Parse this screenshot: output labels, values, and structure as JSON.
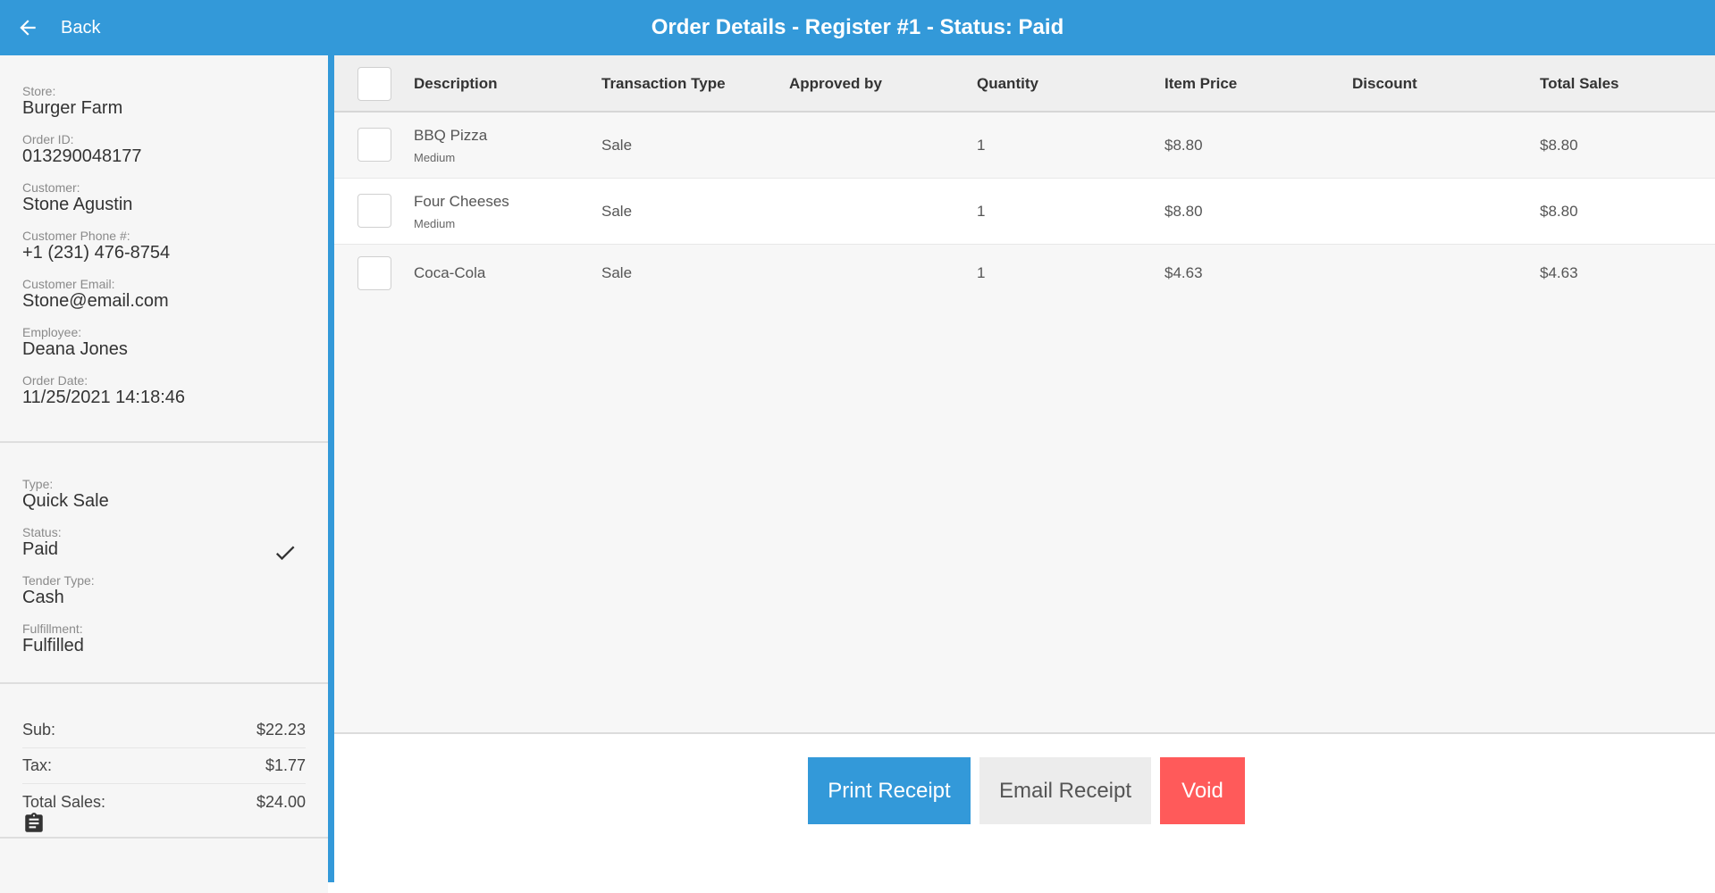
{
  "header": {
    "back_label": "Back",
    "title": "Order Details - Register #1 - Status: Paid"
  },
  "sidebar": {
    "order_info": [
      {
        "label": "Store:",
        "value": "Burger Farm"
      },
      {
        "label": "Order ID:",
        "value": "013290048177"
      },
      {
        "label": "Customer:",
        "value": "Stone Agustin"
      },
      {
        "label": "Customer Phone #:",
        "value": "+1 (231) 476-8754"
      },
      {
        "label": "Customer Email:",
        "value": "Stone@email.com"
      },
      {
        "label": "Employee:",
        "value": "Deana Jones"
      },
      {
        "label": "Order Date:",
        "value": "11/25/2021 14:18:46"
      }
    ],
    "status_info": [
      {
        "label": "Type:",
        "value": "Quick Sale"
      },
      {
        "label": "Status:",
        "value": "Paid"
      },
      {
        "label": "Tender Type:",
        "value": "Cash"
      },
      {
        "label": "Fulfillment:",
        "value": "Fulfilled"
      }
    ],
    "totals": [
      {
        "label": "Sub:",
        "value": "$22.23"
      },
      {
        "label": "Tax:",
        "value": "$1.77"
      },
      {
        "label": "Total Sales:",
        "value": "$24.00"
      }
    ]
  },
  "table": {
    "columns": [
      "Description",
      "Transaction Type",
      "Approved by",
      "Quantity",
      "Item Price",
      "Discount",
      "Total Sales"
    ],
    "rows": [
      {
        "description": "BBQ Pizza",
        "modifier": "Medium",
        "type": "Sale",
        "approved_by": "",
        "quantity": "1",
        "item_price": "$8.80",
        "discount": "",
        "total": "$8.80"
      },
      {
        "description": "Four Cheeses",
        "modifier": "Medium",
        "type": "Sale",
        "approved_by": "",
        "quantity": "1",
        "item_price": "$8.80",
        "discount": "",
        "total": "$8.80"
      },
      {
        "description": "Coca-Cola",
        "modifier": "",
        "type": "Sale",
        "approved_by": "",
        "quantity": "1",
        "item_price": "$4.63",
        "discount": "",
        "total": "$4.63"
      }
    ]
  },
  "actions": {
    "print_label": "Print Receipt",
    "email_label": "Email Receipt",
    "void_label": "Void"
  },
  "colors": {
    "primary": "#3399d9",
    "void": "#ff5a5a"
  }
}
